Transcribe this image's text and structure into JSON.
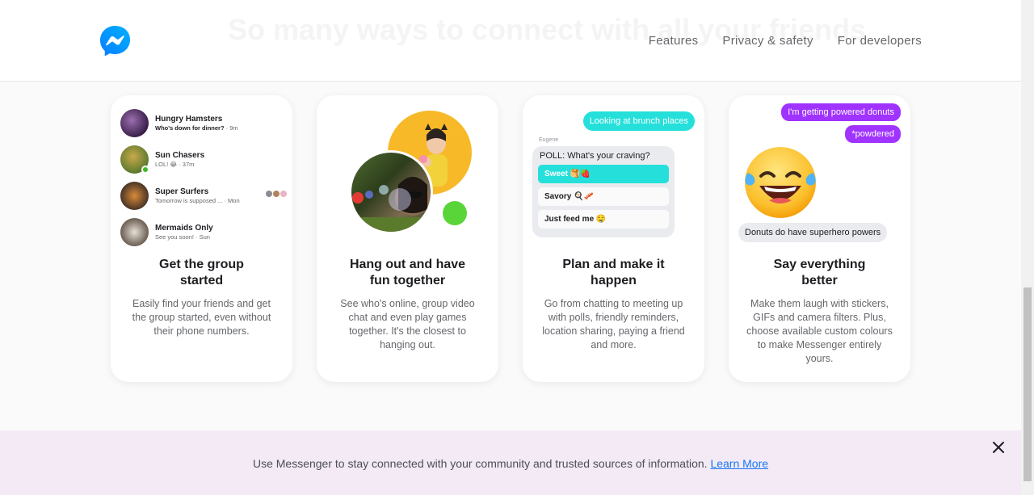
{
  "header": {
    "ghost_heading": "So many ways to connect with all your friends",
    "logo_icon": "messenger-logo-icon",
    "nav": [
      "Features",
      "Privacy & safety",
      "For developers"
    ]
  },
  "cards": [
    {
      "title": "Get the group started",
      "description": "Easily find your friends and get the group started, even without their phone numbers.",
      "chats": [
        {
          "name": "Hungry Hamsters",
          "preview": "Who's down for dinner?",
          "time": " · 9m"
        },
        {
          "name": "Sun Chasers",
          "preview": "LOL! 😂",
          "time": " · 37m"
        },
        {
          "name": "Super Surfers",
          "preview": "Tomorrow is supposed ...",
          "time": " · Mon"
        },
        {
          "name": "Mermaids Only",
          "preview": "See you soon!",
          "time": " · Sun"
        }
      ]
    },
    {
      "title": "Hang out and have fun together",
      "description": "See who's online, group video chat and even play games together. It's the closest to hanging out."
    },
    {
      "title": "Plan and make it happen",
      "description": "Go from chatting to meeting up with polls, friendly reminders, location sharing, paying a friend and more.",
      "bubble": "Looking at brunch places",
      "sender": "Eugene",
      "poll_question": "POLL: What's your craving?",
      "poll_options": [
        "Sweet 🥞🍓",
        "Savory 🍳🥓",
        "Just feed me 🤤"
      ]
    },
    {
      "title": "Say everything better",
      "description": "Make them laugh with stickers, GIFs and camera filters. Plus, choose available custom colours to make Messenger entirely yours.",
      "bubble1": "I'm getting powered donuts",
      "bubble2": "*powdered",
      "bubble3": "Donuts do have superhero powers"
    }
  ],
  "footer": {
    "text": "Use Messenger to stay connected with your community and trusted sources of information. ",
    "link": "Learn More"
  },
  "colors": {
    "accent_blue": "#1877f2",
    "teal": "#25e0da",
    "purple": "#a033ff",
    "yellow": "#f7b928",
    "green": "#5ad539"
  }
}
